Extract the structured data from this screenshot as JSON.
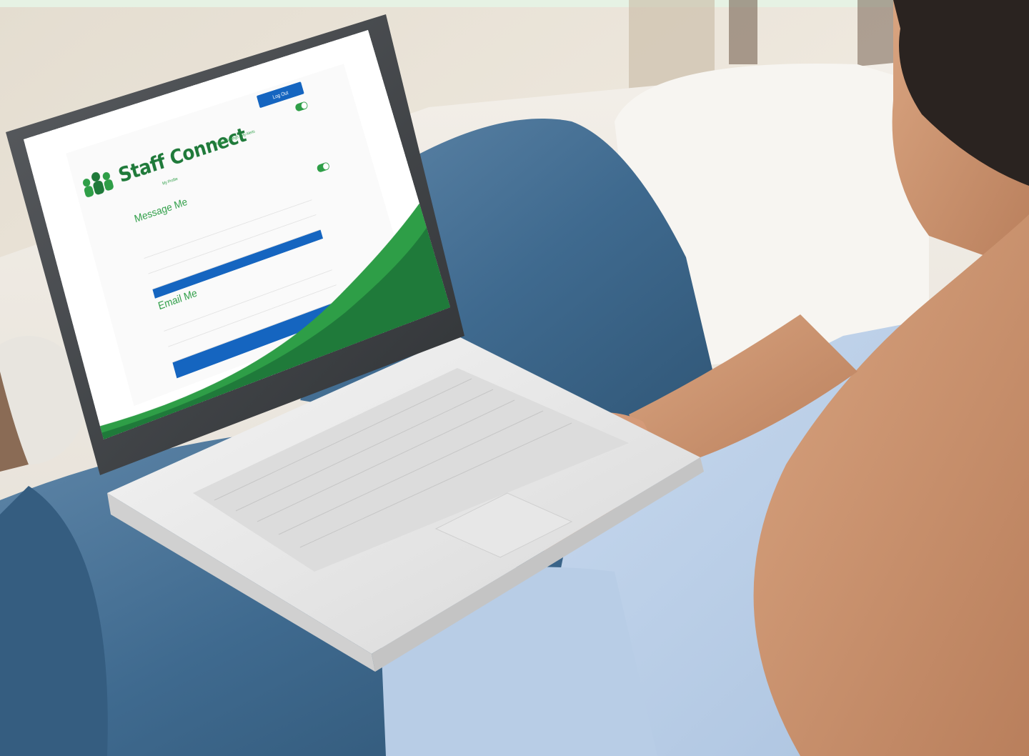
{
  "app": {
    "brand": "Staff Connect",
    "logout_label": "Log Out"
  },
  "nav": {
    "profile_label": "My Profile",
    "profile_sub": "",
    "settings_label": "Notice Settings · My Alerts",
    "settings_sub": ""
  },
  "message_me": {
    "title": "Message Me",
    "description": "",
    "options": [
      "",
      "",
      ""
    ]
  },
  "email_me": {
    "title": "Email Me",
    "description": "",
    "options": [
      "",
      "",
      "",
      ""
    ]
  },
  "colors": {
    "brand_green": "#2e9e47",
    "brand_dark_green": "#1f7a3a",
    "accent_blue": "#1565c0"
  },
  "icons": [
    "people-logo-icon",
    "profile-icon",
    "settings-icon",
    "toggle-icon"
  ]
}
